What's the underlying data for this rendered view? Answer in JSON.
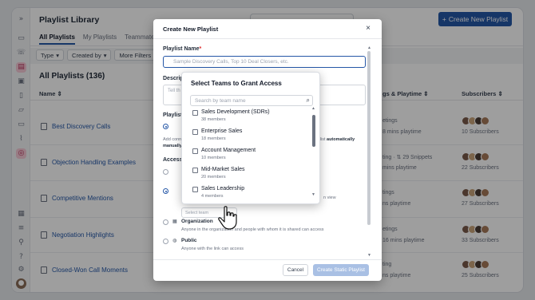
{
  "app": {
    "title": "Playlist Library",
    "create_button": "Create New Playlist",
    "tabs": [
      "All Playlists",
      "My Playlists",
      "Teammate"
    ],
    "filters": [
      {
        "label": "Type"
      },
      {
        "label": "Created by"
      },
      {
        "label": "More Filters"
      }
    ],
    "count_title": "All Playlists (136)",
    "columns": {
      "name": "Name",
      "listings": "gs & Playtime",
      "subscribers": "Subscribers"
    },
    "rows": [
      {
        "name": "Best Discovery Calls",
        "stats_line1": "etings",
        "stats_line2": "8 mins playtime",
        "subscribers": "10 Subscribers"
      },
      {
        "name": "Objection Handling Examples",
        "stats_line1": "ting · ⇅ 29 Snippets",
        "stats_line2": "mins playtime",
        "subscribers": "22 Subscribers"
      },
      {
        "name": "Competitive Mentions",
        "stats_line1": "tings",
        "stats_line2": "ns playtime",
        "subscribers": "27 Subscribers"
      },
      {
        "name": "Negotiation Highlights",
        "stats_line1": "etings",
        "stats_line2": "16 mins playtime",
        "subscribers": "33 Subscribers"
      },
      {
        "name": "Closed-Won Call Moments",
        "stats_line1": "ting",
        "stats_line2": "ns playtime",
        "subscribers": "25 Subscribers"
      }
    ],
    "avatar_colors": [
      "#7a5a4a",
      "#c9a37a",
      "#4a3a33",
      "#a77a5a"
    ]
  },
  "modal": {
    "title": "Create New Playlist",
    "close_icon": "close-icon",
    "name_label": "Playlist Name",
    "name_placeholder": "Sample Discovery Calls, Top 10 Deal Closers, etc.",
    "description_label": "Descrip",
    "description_placeholder": "Tell th",
    "type_label": "Playlist",
    "auto_note_a": "Add conn",
    "auto_note_b": "ylist",
    "auto_note_bold": "automatically",
    "auto_note_c": "manually",
    "access_label": "Access",
    "view_suffix": "n view",
    "select_team_placeholder": "Select team",
    "options": [
      {
        "title": "Organization",
        "desc": "Anyone in the organization and people with whom it is shared can access"
      },
      {
        "title": "Public",
        "desc": "Anyone with the link can access"
      }
    ],
    "cancel": "Cancel",
    "primary": "Create Static Playlist"
  },
  "team_dropdown": {
    "title": "Select Teams to Grant Access",
    "search_placeholder": "Search by team name",
    "teams": [
      {
        "name": "Sales Development (SDRs)",
        "members": "38 members",
        "checked": false
      },
      {
        "name": "Enterprise Sales",
        "members": "18 members",
        "checked": false
      },
      {
        "name": "Account Management",
        "members": "10 members",
        "checked": false
      },
      {
        "name": "Mid-Market Sales",
        "members": "20 members",
        "checked": false
      },
      {
        "name": "Sales Leadership",
        "members": "4 members",
        "checked": false
      }
    ]
  },
  "colors": {
    "accent": "#2557a7",
    "active_rail": "#f6c9d6",
    "primary_disabled": "#a9c0e4"
  }
}
